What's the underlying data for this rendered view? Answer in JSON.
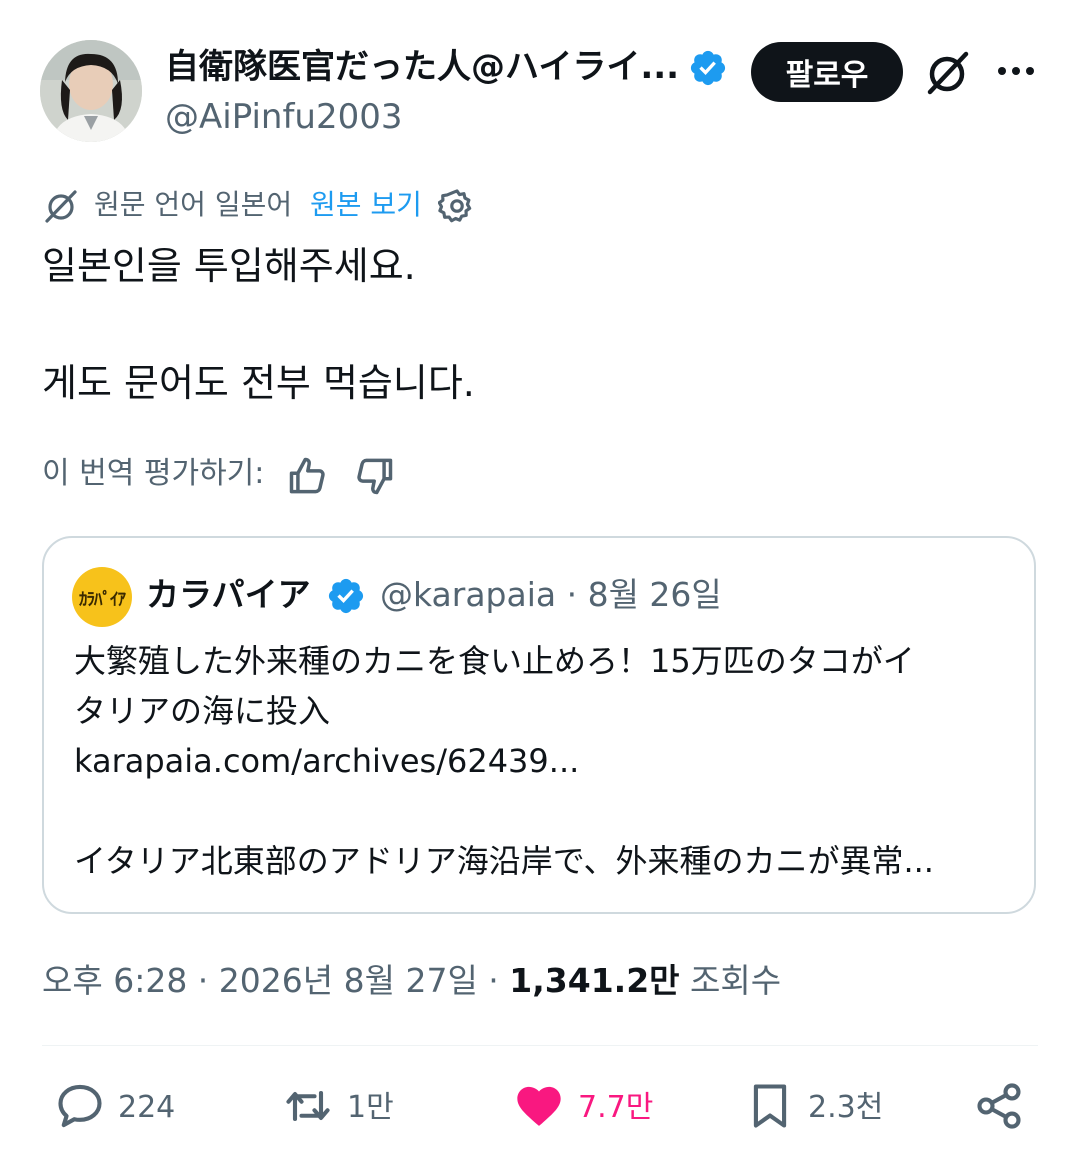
{
  "author": {
    "display_name": "自衛隊医官だった人@ハイライ...",
    "handle": "@AiPinfu2003"
  },
  "header": {
    "follow_label": "팔로우"
  },
  "translation_bar": {
    "source_text": "원문 언어 일본어",
    "show_original_label": "원본 보기"
  },
  "tweet": {
    "lines": [
      "일본인을 투입해주세요.",
      "게도 문어도 전부 먹습니다."
    ]
  },
  "rating": {
    "prompt": "이 번역 평가하기:"
  },
  "quote": {
    "avatar_text": "ｶﾗﾊﾟｲｱ",
    "name": "カラパイア",
    "meta": "@karapaia · 8월 26일",
    "lines": [
      "大繁殖した外来種のカニを食い止めろ！15万匹のタコがイ",
      "タリアの海に投入",
      "karapaia.com/archives/62439...",
      "イタリア北東部のアドリア海沿岸で、外来種のカニが異常..."
    ]
  },
  "timestamp": {
    "prefix": "오후 6:28 · 2026년 8월 27일 · ",
    "views_count": "1,341.2만",
    "views_label": " 조회수"
  },
  "actions": {
    "replies": "224",
    "reposts": "1만",
    "likes": "7.7만",
    "bookmarks": "2.3천"
  },
  "colors": {
    "accent": "#1d9bf0",
    "like": "#f91880",
    "muted": "#536471",
    "text": "#0f1419"
  }
}
